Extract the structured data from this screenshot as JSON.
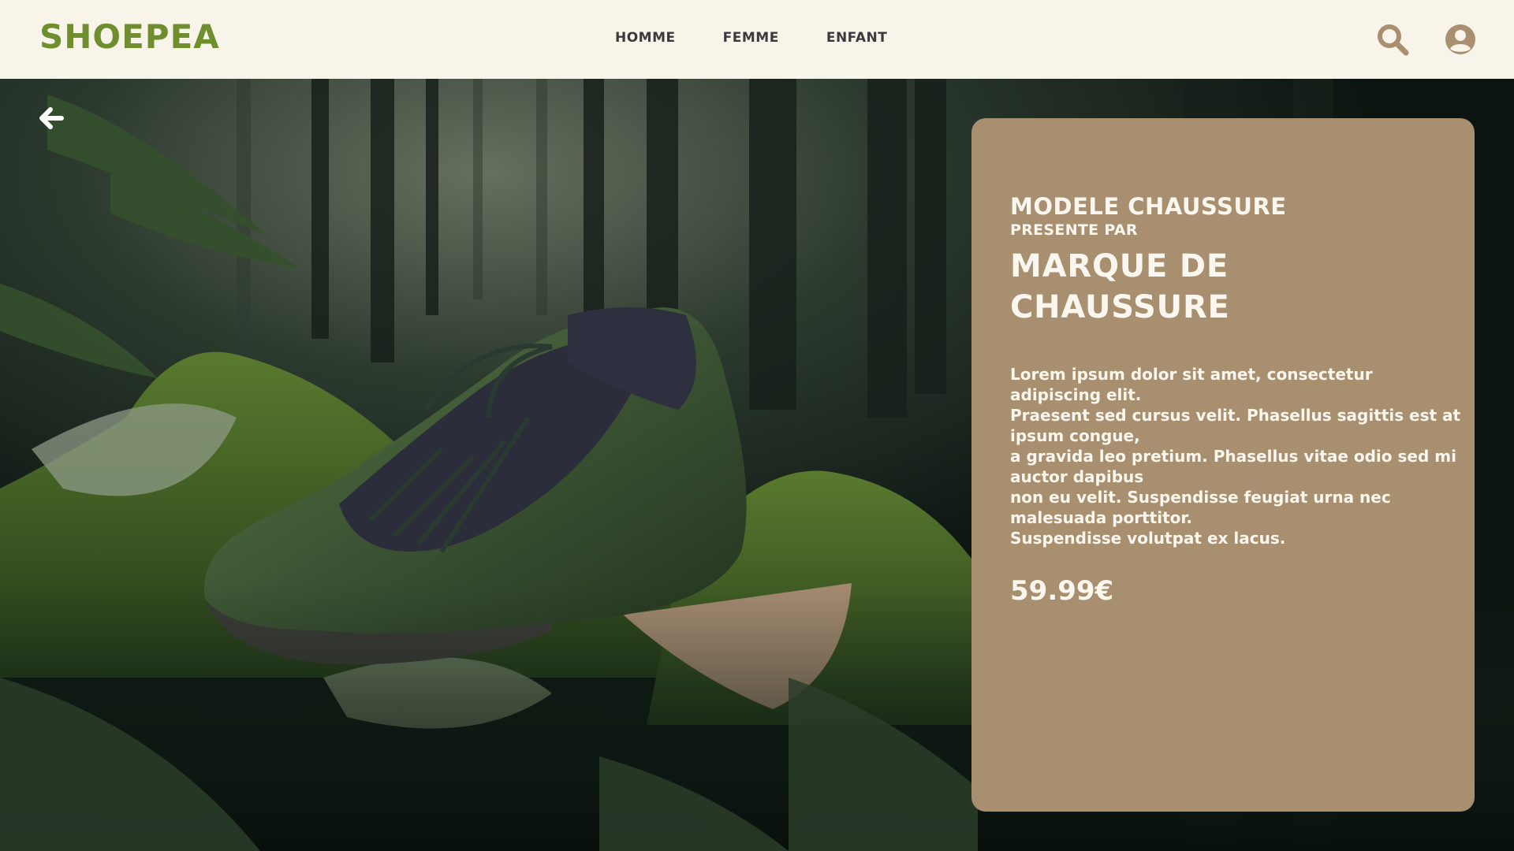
{
  "header": {
    "logo": "SHOEPEA",
    "nav": [
      "HOMME",
      "FEMME",
      "ENFANT"
    ],
    "icons": {
      "search": "search-icon",
      "account": "user-circle-icon"
    }
  },
  "hero": {
    "back_icon": "arrow-left-icon",
    "image": "sneaker-in-mossy-forest"
  },
  "product": {
    "model": "MODELE CHAUSSURE",
    "presented_by": "PRESENTE PAR",
    "brand": "MARQUE DE CHAUSSURE",
    "description_lines": [
      "Lorem ipsum dolor sit amet, consectetur",
      "adipiscing elit.",
      "Praesent sed cursus velit. Phasellus sagittis est at",
      "ipsum congue,",
      "a gravida leo pretium. Phasellus vitae odio sed mi",
      "auctor dapibus",
      "non eu velit. Suspendisse feugiat urna nec",
      "malesuada porttitor.",
      "Suspendisse volutpat ex lacus."
    ],
    "price": "59.99€"
  },
  "colors": {
    "header_bg": "#f8f4ea",
    "logo": "#6f8f2e",
    "card_bg": "#a88f6f",
    "card_text": "#fbf7ef",
    "icon": "#a88f6f"
  }
}
